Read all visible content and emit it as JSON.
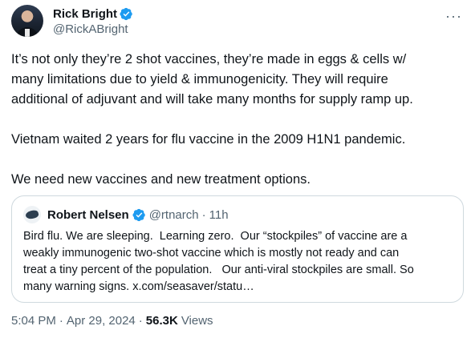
{
  "author": {
    "name": "Rick Bright",
    "handle": "@RickABright"
  },
  "menu": {
    "more_label": "···"
  },
  "tweet": {
    "text": "It’s not only they’re 2 shot vaccines, they’re made in eggs & cells w/\nmany limitations due to yield & immunogenicity. They will require\nadditional of adjuvant and will take many months for supply ramp up.\n\nVietnam waited 2 years for flu vaccine in the 2009 H1N1 pandemic.\n\nWe need new vaccines and new treatment options."
  },
  "quote": {
    "name": "Robert Nelsen",
    "handle": "@rtnarch",
    "separator": "·",
    "time": "11h",
    "text": "Bird flu. We are sleeping.  Learning zero.  Our “stockpiles” of vaccine are a\nweakly immunogenic two-shot vaccine which is mostly not ready and can\ntreat a tiny percent of the population.   Our anti-viral stockpiles are small. So\nmany warning signs. x.com/seasaver/statu…"
  },
  "footer": {
    "time": "5:04 PM",
    "sep1": "·",
    "date": "Apr 29, 2024",
    "sep2": "·",
    "views_count": "56.3K",
    "views_label": "Views"
  },
  "colors": {
    "verified": "#1d9bf0",
    "secondary_text": "#536471",
    "border": "#cfd9de"
  },
  "icons": [
    "verified-badge-icon",
    "more-icon"
  ]
}
